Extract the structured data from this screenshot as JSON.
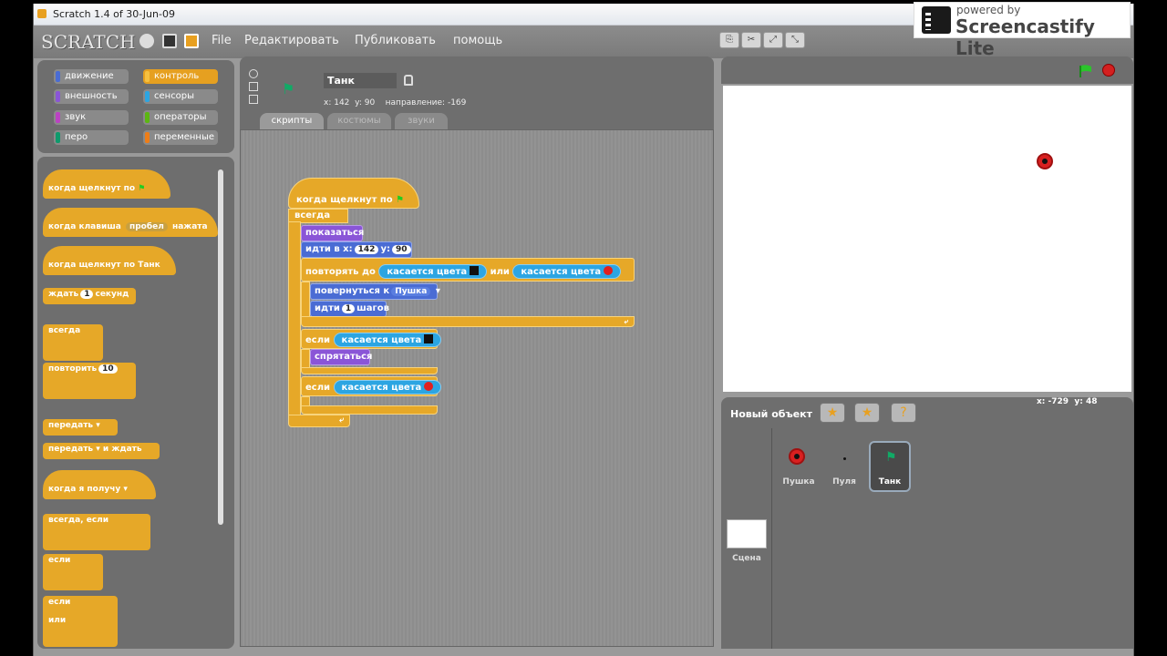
{
  "window": {
    "title": "Scratch 1.4 of 30-Jun-09"
  },
  "watermark": {
    "small": "powered by",
    "big": "Screencastify Lite"
  },
  "menu": {
    "logo": "SCRATCH",
    "items": [
      "File",
      "Редактировать",
      "Публиковать",
      "помощь"
    ]
  },
  "categories": [
    {
      "label": "движение",
      "color": "#4a6cd4"
    },
    {
      "label": "контроль",
      "color": "#e6a828",
      "active": true
    },
    {
      "label": "внешность",
      "color": "#8a55d7"
    },
    {
      "label": "сенсоры",
      "color": "#2ca5e2"
    },
    {
      "label": "звук",
      "color": "#bb42c3"
    },
    {
      "label": "операторы",
      "color": "#5cb712"
    },
    {
      "label": "перо",
      "color": "#0e9a6c"
    },
    {
      "label": "переменные",
      "color": "#ee7d16"
    }
  ],
  "palette": {
    "when_flag": "когда щелкнут по",
    "when_key": "когда клавиша",
    "key_value": "пробел",
    "key_suffix": "нажата",
    "when_clicked": "когда щелкнут по Танк",
    "wait": "ждать",
    "wait_value": "1",
    "wait_suffix": "секунд",
    "forever": "всегда",
    "repeat": "повторить",
    "repeat_value": "10",
    "broadcast": "передать",
    "broadcast_wait_a": "передать",
    "broadcast_wait_b": "и ждать",
    "when_receive": "когда я получу",
    "forever_if": "всегда, если",
    "if1": "если",
    "if2": "если",
    "else": "или"
  },
  "sprite": {
    "name": "Танк",
    "x_label": "x:",
    "x": "142",
    "y_label": "y:",
    "y": "90",
    "dir_label": "направление:",
    "direction": "-169"
  },
  "tabs": [
    {
      "label": "скрипты",
      "active": true
    },
    {
      "label": "костюмы",
      "active": false
    },
    {
      "label": "звуки",
      "active": false
    }
  ],
  "script": {
    "hat": "когда щелкнут по",
    "forever": "всегда",
    "show": "показаться",
    "goto": "идти в x:",
    "goto_x": "142",
    "goto_y_label": "y:",
    "goto_y": "90",
    "repeat_until": "повторять до",
    "touch_color1": "касается цвета",
    "or": "или",
    "touch_color2": "касается цвета",
    "point_towards": "повернуться к",
    "point_target": "Пушка",
    "move": "идти",
    "move_value": "1",
    "move_suffix": "шагов",
    "if1": "если",
    "touch_color3": "касается цвета",
    "hide": "спрятаться",
    "if2": "если",
    "touch_color4": "касается цвета",
    "colors": {
      "black": "#111111",
      "red": "#e02020"
    }
  },
  "stage": {
    "mouse_x_label": "x:",
    "mouse_x": "-729",
    "mouse_y_label": "y:",
    "mouse_y": "48"
  },
  "new_object": {
    "label": "Новый объект"
  },
  "sprites": [
    {
      "name": "Пушка"
    },
    {
      "name": "Пуля"
    },
    {
      "name": "Танк",
      "selected": true
    }
  ],
  "scene": {
    "label": "Сцена"
  }
}
